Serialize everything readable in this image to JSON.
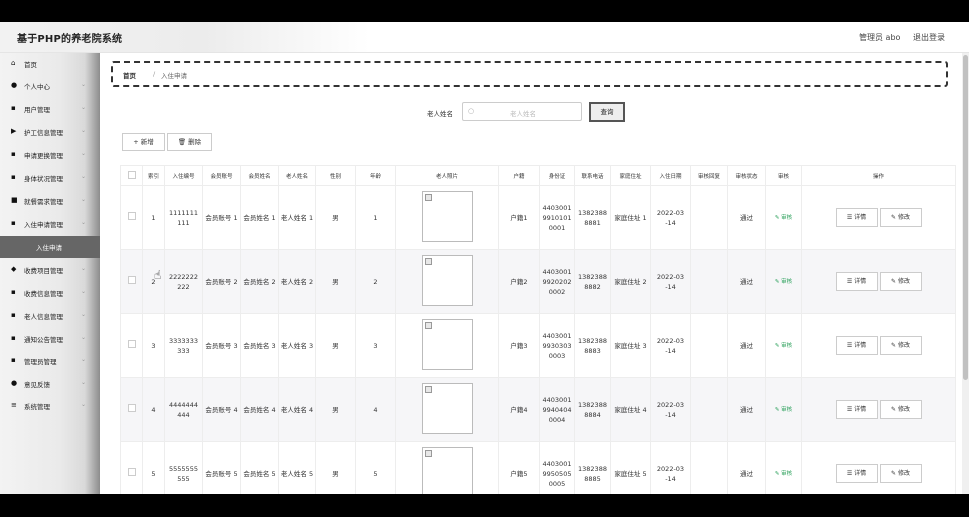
{
  "header": {
    "title": "基于PHP的养老院系统",
    "admin": "管理员 abo",
    "logout": "退出登录"
  },
  "sidebar": {
    "items": [
      {
        "label": "首页",
        "icon": "home-icon",
        "glyph": "⌂"
      },
      {
        "label": "个人中心",
        "icon": "user-icon",
        "glyph": "●"
      },
      {
        "label": "用户管理",
        "icon": "grid-icon",
        "glyph": "▪"
      },
      {
        "label": "护工信息管理",
        "icon": "flag-icon",
        "glyph": "▶"
      },
      {
        "label": "申请更换管理",
        "icon": "grid-icon",
        "glyph": "▪"
      },
      {
        "label": "身体状况管理",
        "icon": "grid-icon",
        "glyph": "▪"
      },
      {
        "label": "就餐需求管理",
        "icon": "doc-icon",
        "glyph": "■"
      },
      {
        "label": "入住申请管理",
        "icon": "grid-icon",
        "glyph": "▪"
      },
      {
        "label": "入住申请",
        "sub": true
      },
      {
        "label": "收费项目管理",
        "icon": "tag-icon",
        "glyph": "◆"
      },
      {
        "label": "收费信息管理",
        "icon": "grid-icon",
        "glyph": "▪"
      },
      {
        "label": "老人信息管理",
        "icon": "grid-icon",
        "glyph": "▪"
      },
      {
        "label": "通知公告管理",
        "icon": "grid-icon",
        "glyph": "▪"
      },
      {
        "label": "管理员管理",
        "icon": "grid-icon",
        "glyph": "▪"
      },
      {
        "label": "意见反馈",
        "icon": "pin-icon",
        "glyph": "●"
      },
      {
        "label": "系统管理",
        "icon": "menu-icon",
        "glyph": "≡"
      }
    ]
  },
  "breadcrumb": {
    "home": "首页",
    "sep": "/",
    "current": "入住申请"
  },
  "search": {
    "label": "老人姓名",
    "placeholder": "老人姓名",
    "button": "查询"
  },
  "toolbar": {
    "add": "+ 新增",
    "delete": "🗑 删除"
  },
  "table": {
    "columns": [
      "",
      "索引",
      "入住编号",
      "会员账号",
      "会员姓名",
      "老人姓名",
      "性别",
      "年龄",
      "老人照片",
      "户籍",
      "身份证",
      "联系电话",
      "家庭住址",
      "入住日期",
      "审核回复",
      "审核状态",
      "审核",
      "操作"
    ],
    "rows": [
      {
        "index": "1",
        "code": "1111111 111",
        "account": "会员账号 1",
        "member": "会员姓名 1",
        "elder": "老人姓名 1",
        "gender": "男",
        "age": "1",
        "huji": "户籍1",
        "idcard": "4403001 9910101 0001",
        "phone": "1382388 8881",
        "address": "家庭住址 1",
        "date": "2022-03 -14",
        "reply": "",
        "status": "通过",
        "audit": "✎ 审核",
        "detail": "☰ 详情",
        "edit": "✎ 修改"
      },
      {
        "index": "2",
        "code": "2222222 222",
        "account": "会员账号 2",
        "member": "会员姓名 2",
        "elder": "老人姓名 2",
        "gender": "男",
        "age": "2",
        "huji": "户籍2",
        "idcard": "4403001 9920202 0002",
        "phone": "1382388 8882",
        "address": "家庭住址 2",
        "date": "2022-03 -14",
        "reply": "",
        "status": "通过",
        "audit": "✎ 审核",
        "detail": "☰ 详情",
        "edit": "✎ 修改"
      },
      {
        "index": "3",
        "code": "3333333 333",
        "account": "会员账号 3",
        "member": "会员姓名 3",
        "elder": "老人姓名 3",
        "gender": "男",
        "age": "3",
        "huji": "户籍3",
        "idcard": "4403001 9930303 0003",
        "phone": "1382388 8883",
        "address": "家庭住址 3",
        "date": "2022-03 -14",
        "reply": "",
        "status": "通过",
        "audit": "✎ 审核",
        "detail": "☰ 详情",
        "edit": "✎ 修改"
      },
      {
        "index": "4",
        "code": "4444444 444",
        "account": "会员账号 4",
        "member": "会员姓名 4",
        "elder": "老人姓名 4",
        "gender": "男",
        "age": "4",
        "huji": "户籍4",
        "idcard": "4403001 9940404 0004",
        "phone": "1382388 8884",
        "address": "家庭住址 4",
        "date": "2022-03 -14",
        "reply": "",
        "status": "通过",
        "audit": "✎ 审核",
        "detail": "☰ 详情",
        "edit": "✎ 修改"
      },
      {
        "index": "5",
        "code": "5555555 555",
        "account": "会员账号 5",
        "member": "会员姓名 5",
        "elder": "老人姓名 5",
        "gender": "男",
        "age": "5",
        "huji": "户籍5",
        "idcard": "4403001 9950505 0005",
        "phone": "1382388 8885",
        "address": "家庭住址 5",
        "date": "2022-03 -14",
        "reply": "",
        "status": "通过",
        "audit": "✎ 审核",
        "detail": "☰ 详情",
        "edit": "✎ 修改"
      }
    ]
  },
  "colors": {
    "accent": "#2aa05a",
    "active_menu": "#666666"
  }
}
